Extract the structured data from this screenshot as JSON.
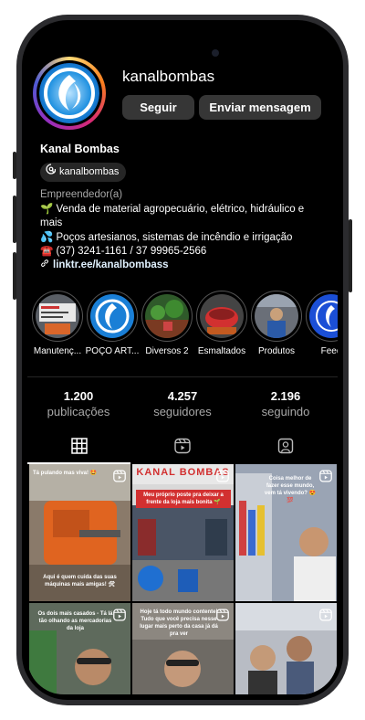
{
  "profile": {
    "username": "kanalbombas",
    "display_name": "Kanal Bombas",
    "threads_handle": "kanalbombas",
    "category": "Empreendedor(a)",
    "bio_line1": "🌱 Venda de material agropecuário, elétrico, hidráulico e mais",
    "bio_line2": "💦 Poços artesianos, sistemas de incêndio e irrigação",
    "bio_line3": "☎️ (37) 3241-1161 / 37 99965-2566",
    "link": "linktr.ee/kanalbombass"
  },
  "actions": {
    "follow": "Seguir",
    "message": "Enviar mensagem"
  },
  "highlights": [
    {
      "label": "Manutenç...",
      "icon": "maintenance-photo"
    },
    {
      "label": "POÇO ART...",
      "icon": "water-drop-logo"
    },
    {
      "label": "Diversos 2",
      "icon": "plants-photo"
    },
    {
      "label": "Esmaltados",
      "icon": "enameled-photo"
    },
    {
      "label": "Produtos",
      "icon": "products-photo"
    },
    {
      "label": "Feed",
      "icon": "feed-logo"
    }
  ],
  "stats": [
    {
      "value": "1.200",
      "label": "publicações"
    },
    {
      "value": "4.257",
      "label": "seguidores"
    },
    {
      "value": "2.196",
      "label": "seguindo"
    }
  ],
  "tabs": [
    "grid-icon",
    "reels-icon",
    "tagged-icon"
  ],
  "posts": [
    {
      "caption_top": "Tá pulando mas viva! 🤩",
      "caption_bottom": "Aqui é quem cuida das suas máquinas mais amigas! 🛠",
      "icon": "reels-icon"
    },
    {
      "caption_top": "KANAL BOMBAS",
      "caption_bottom": "Meu próprio poste pra deixar a frente da loja mais bonita 🌱",
      "icon": "reels-icon"
    },
    {
      "caption_top": "Coisa melhor de fazer esse mundo, vem tá vivendo? 😍💯",
      "caption_bottom": "",
      "icon": "reels-icon"
    },
    {
      "caption_top": "Os dois mais casados - Tá lá tão olhando as mercadorias da loja",
      "caption_bottom": "",
      "icon": "reels-icon"
    },
    {
      "caption_top": "Hoje tá todo mundo contente! Tudo que você precisa nesse lugar mais perto da casa já dá pra ver",
      "caption_bottom": "",
      "icon": "reels-icon"
    },
    {
      "caption_top": "",
      "caption_bottom": "",
      "icon": "reels-icon"
    }
  ]
}
